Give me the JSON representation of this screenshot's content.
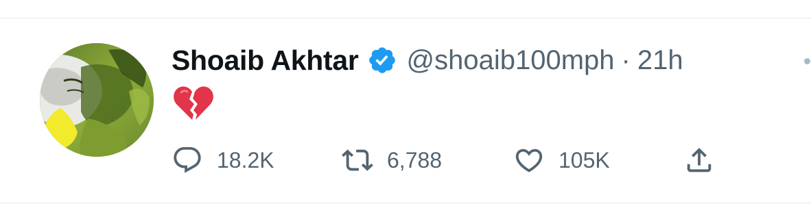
{
  "tweet": {
    "author": {
      "name": "Shoaib Akhtar",
      "handle": "@shoaib100mph",
      "verified": true,
      "verified_icon": "verified-badge-icon",
      "avatar_icon": "avatar-photo"
    },
    "separator": "·",
    "timestamp": "21h",
    "content_emoji": "broken-heart-icon",
    "actions": {
      "reply": {
        "icon": "reply-icon",
        "count": "18.2K"
      },
      "retweet": {
        "icon": "retweet-icon",
        "count": "6,788"
      },
      "like": {
        "icon": "heart-icon",
        "count": "105K"
      },
      "share": {
        "icon": "share-icon"
      }
    },
    "more_icon": "more-icon"
  },
  "colors": {
    "text_primary": "#0f1419",
    "text_secondary": "#536471",
    "verified_blue": "#1d9bf0",
    "broken_heart_red": "#e2344a",
    "divider": "#e6e6e6"
  }
}
